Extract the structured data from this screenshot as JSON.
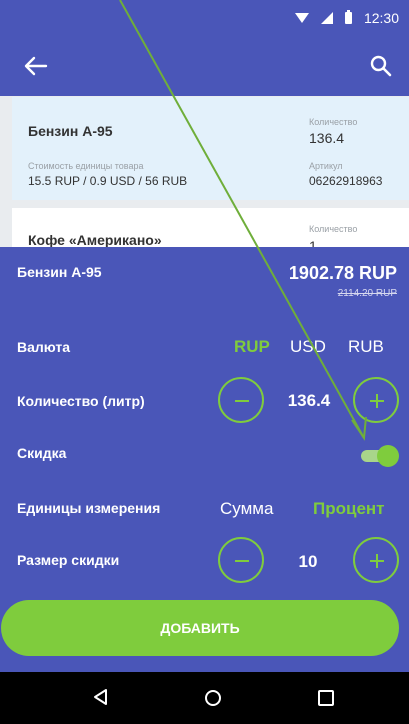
{
  "status_bar": {
    "time": "12:30"
  },
  "list": {
    "item1": {
      "name": "Бензин А-95",
      "qty_label": "Количество",
      "qty": "136.4",
      "cost_label": "Стоимость единицы товара",
      "cost": "15.5 RUP / 0.9 USD / 56 RUB",
      "article_label": "Артикул",
      "article": "06262918963"
    },
    "item2": {
      "name": "Кофе «Американо»",
      "qty_label": "Количество",
      "qty": "1"
    }
  },
  "sheet": {
    "title": "Бензин А-95",
    "price": "1902.78 RUP",
    "old_price": "2114.20 RUP",
    "currency_label": "Валюта",
    "currencies": [
      "RUP",
      "USD",
      "RUB"
    ],
    "selected_currency": "RUP",
    "quantity_label": "Количество (литр)",
    "quantity": "136.4",
    "discount_label": "Скидка",
    "discount_enabled": true,
    "units_label": "Единицы измерения",
    "units": [
      "Сумма",
      "Процент"
    ],
    "selected_unit": "Процент",
    "discount_size_label": "Размер скидки",
    "discount_size": "10",
    "add_button": "ДОБАВИТЬ"
  },
  "colors": {
    "primary": "#4a56b8",
    "accent": "#7fcc3d",
    "card_selected": "#e3f1fb"
  },
  "icons": {
    "back": "arrow-left-icon",
    "search": "search-icon",
    "minus": "minus-icon",
    "plus": "plus-icon",
    "nav_back": "triangle-back-icon",
    "nav_home": "circle-home-icon",
    "nav_recent": "square-recent-icon"
  }
}
